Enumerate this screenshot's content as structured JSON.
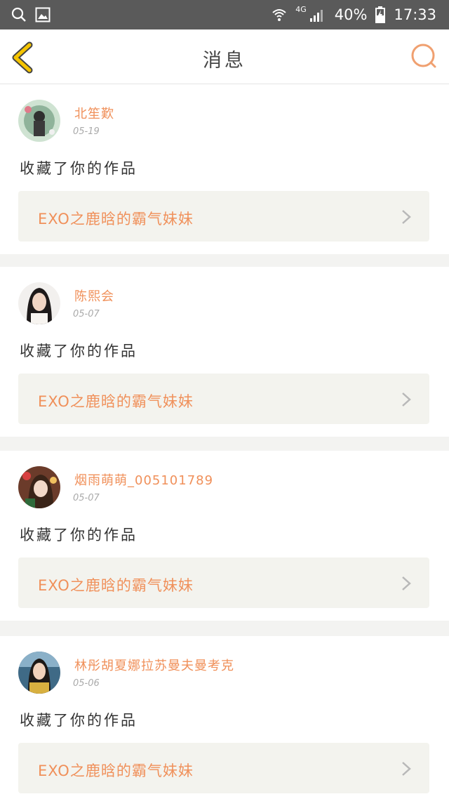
{
  "status_bar": {
    "network": "4G",
    "battery": "40%",
    "time": "17:33"
  },
  "nav": {
    "title": "消息"
  },
  "colors": {
    "accent": "#f0905a",
    "back_arrow": "#f5c400",
    "background": "#f3f3f1"
  },
  "messages": [
    {
      "username": "北笙歎",
      "date": "05-19",
      "action": "收藏了你的作品",
      "work_title": "EXO之鹿晗的霸气妹妹"
    },
    {
      "username": "陈熙会",
      "date": "05-07",
      "action": "收藏了你的作品",
      "work_title": "EXO之鹿晗的霸气妹妹"
    },
    {
      "username": "烟雨萌萌_005101789",
      "date": "05-07",
      "action": "收藏了你的作品",
      "work_title": "EXO之鹿晗的霸气妹妹"
    },
    {
      "username": "林彤胡夏娜拉苏曼夫曼考克",
      "date": "05-06",
      "action": "收藏了你的作品",
      "work_title": "EXO之鹿晗的霸气妹妹"
    }
  ]
}
